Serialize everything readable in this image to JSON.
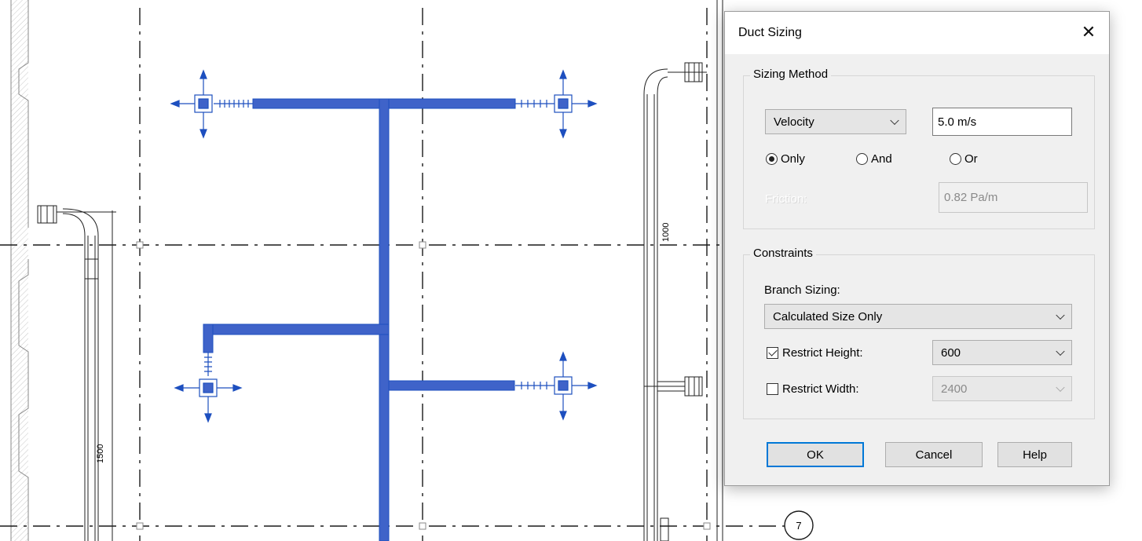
{
  "drawing": {
    "dimension_labels": [
      "1000",
      "1500"
    ],
    "grid_bubble": "7",
    "duct_color": "#3f63c9",
    "outline_color": "#1d4fbf"
  },
  "dialog": {
    "title": "Duct Sizing",
    "close_icon": "close-icon",
    "sizing_method": {
      "legend": "Sizing Method",
      "method_value": "Velocity",
      "velocity_value": "5.0 m/s",
      "radio_only": "Only",
      "radio_and": "And",
      "radio_or": "Or",
      "selected_radio": "Only",
      "friction_label": "Friction:",
      "friction_value": "0.82 Pa/m"
    },
    "constraints": {
      "legend": "Constraints",
      "branch_sizing_label": "Branch Sizing:",
      "branch_sizing_value": "Calculated Size Only",
      "restrict_height_label": "Restrict Height:",
      "restrict_height_checked": true,
      "restrict_height_value": "600",
      "restrict_width_label": "Restrict Width:",
      "restrict_width_checked": false,
      "restrict_width_value": "2400"
    },
    "buttons": {
      "ok": "OK",
      "cancel": "Cancel",
      "help": "Help"
    }
  }
}
